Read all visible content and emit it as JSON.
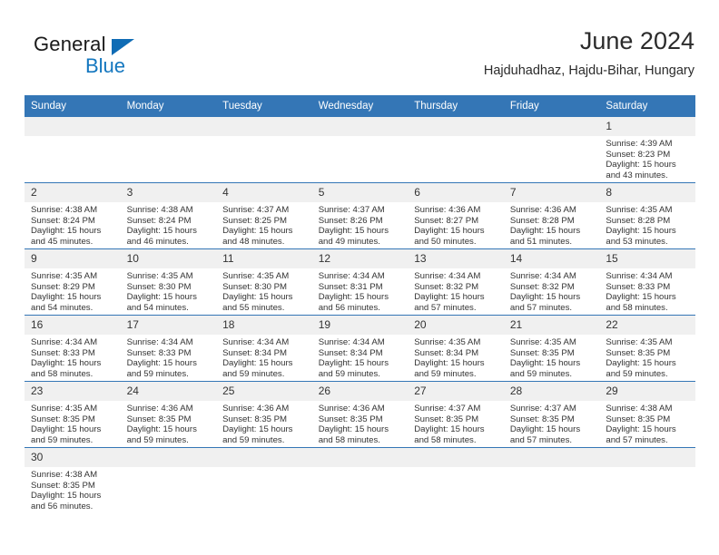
{
  "logo": {
    "word1": "General",
    "word2": "Blue",
    "triangle_color": "#0f6cb5",
    "word2_color": "#1477bf"
  },
  "header": {
    "title": "June 2024",
    "subtitle": "Hajduhadhaz, Hajdu-Bihar, Hungary"
  },
  "theme": {
    "header_blue": "#3476b6",
    "daynum_bg": "#f0f0f0",
    "text": "#333333"
  },
  "weekdays": [
    "Sunday",
    "Monday",
    "Tuesday",
    "Wednesday",
    "Thursday",
    "Friday",
    "Saturday"
  ],
  "labels": {
    "sunrise": "Sunrise:",
    "sunset": "Sunset:",
    "daylight": "Daylight:"
  },
  "weeks": [
    [
      {
        "day": "",
        "empty": true
      },
      {
        "day": "",
        "empty": true
      },
      {
        "day": "",
        "empty": true
      },
      {
        "day": "",
        "empty": true
      },
      {
        "day": "",
        "empty": true
      },
      {
        "day": "",
        "empty": true
      },
      {
        "day": "1",
        "sunrise": "Sunrise: 4:39 AM",
        "sunset": "Sunset: 8:23 PM",
        "daylight": "Daylight: 15 hours and 43 minutes."
      }
    ],
    [
      {
        "day": "2",
        "sunrise": "Sunrise: 4:38 AM",
        "sunset": "Sunset: 8:24 PM",
        "daylight": "Daylight: 15 hours and 45 minutes."
      },
      {
        "day": "3",
        "sunrise": "Sunrise: 4:38 AM",
        "sunset": "Sunset: 8:24 PM",
        "daylight": "Daylight: 15 hours and 46 minutes."
      },
      {
        "day": "4",
        "sunrise": "Sunrise: 4:37 AM",
        "sunset": "Sunset: 8:25 PM",
        "daylight": "Daylight: 15 hours and 48 minutes."
      },
      {
        "day": "5",
        "sunrise": "Sunrise: 4:37 AM",
        "sunset": "Sunset: 8:26 PM",
        "daylight": "Daylight: 15 hours and 49 minutes."
      },
      {
        "day": "6",
        "sunrise": "Sunrise: 4:36 AM",
        "sunset": "Sunset: 8:27 PM",
        "daylight": "Daylight: 15 hours and 50 minutes."
      },
      {
        "day": "7",
        "sunrise": "Sunrise: 4:36 AM",
        "sunset": "Sunset: 8:28 PM",
        "daylight": "Daylight: 15 hours and 51 minutes."
      },
      {
        "day": "8",
        "sunrise": "Sunrise: 4:35 AM",
        "sunset": "Sunset: 8:28 PM",
        "daylight": "Daylight: 15 hours and 53 minutes."
      }
    ],
    [
      {
        "day": "9",
        "sunrise": "Sunrise: 4:35 AM",
        "sunset": "Sunset: 8:29 PM",
        "daylight": "Daylight: 15 hours and 54 minutes."
      },
      {
        "day": "10",
        "sunrise": "Sunrise: 4:35 AM",
        "sunset": "Sunset: 8:30 PM",
        "daylight": "Daylight: 15 hours and 54 minutes."
      },
      {
        "day": "11",
        "sunrise": "Sunrise: 4:35 AM",
        "sunset": "Sunset: 8:30 PM",
        "daylight": "Daylight: 15 hours and 55 minutes."
      },
      {
        "day": "12",
        "sunrise": "Sunrise: 4:34 AM",
        "sunset": "Sunset: 8:31 PM",
        "daylight": "Daylight: 15 hours and 56 minutes."
      },
      {
        "day": "13",
        "sunrise": "Sunrise: 4:34 AM",
        "sunset": "Sunset: 8:32 PM",
        "daylight": "Daylight: 15 hours and 57 minutes."
      },
      {
        "day": "14",
        "sunrise": "Sunrise: 4:34 AM",
        "sunset": "Sunset: 8:32 PM",
        "daylight": "Daylight: 15 hours and 57 minutes."
      },
      {
        "day": "15",
        "sunrise": "Sunrise: 4:34 AM",
        "sunset": "Sunset: 8:33 PM",
        "daylight": "Daylight: 15 hours and 58 minutes."
      }
    ],
    [
      {
        "day": "16",
        "sunrise": "Sunrise: 4:34 AM",
        "sunset": "Sunset: 8:33 PM",
        "daylight": "Daylight: 15 hours and 58 minutes."
      },
      {
        "day": "17",
        "sunrise": "Sunrise: 4:34 AM",
        "sunset": "Sunset: 8:33 PM",
        "daylight": "Daylight: 15 hours and 59 minutes."
      },
      {
        "day": "18",
        "sunrise": "Sunrise: 4:34 AM",
        "sunset": "Sunset: 8:34 PM",
        "daylight": "Daylight: 15 hours and 59 minutes."
      },
      {
        "day": "19",
        "sunrise": "Sunrise: 4:34 AM",
        "sunset": "Sunset: 8:34 PM",
        "daylight": "Daylight: 15 hours and 59 minutes."
      },
      {
        "day": "20",
        "sunrise": "Sunrise: 4:35 AM",
        "sunset": "Sunset: 8:34 PM",
        "daylight": "Daylight: 15 hours and 59 minutes."
      },
      {
        "day": "21",
        "sunrise": "Sunrise: 4:35 AM",
        "sunset": "Sunset: 8:35 PM",
        "daylight": "Daylight: 15 hours and 59 minutes."
      },
      {
        "day": "22",
        "sunrise": "Sunrise: 4:35 AM",
        "sunset": "Sunset: 8:35 PM",
        "daylight": "Daylight: 15 hours and 59 minutes."
      }
    ],
    [
      {
        "day": "23",
        "sunrise": "Sunrise: 4:35 AM",
        "sunset": "Sunset: 8:35 PM",
        "daylight": "Daylight: 15 hours and 59 minutes."
      },
      {
        "day": "24",
        "sunrise": "Sunrise: 4:36 AM",
        "sunset": "Sunset: 8:35 PM",
        "daylight": "Daylight: 15 hours and 59 minutes."
      },
      {
        "day": "25",
        "sunrise": "Sunrise: 4:36 AM",
        "sunset": "Sunset: 8:35 PM",
        "daylight": "Daylight: 15 hours and 59 minutes."
      },
      {
        "day": "26",
        "sunrise": "Sunrise: 4:36 AM",
        "sunset": "Sunset: 8:35 PM",
        "daylight": "Daylight: 15 hours and 58 minutes."
      },
      {
        "day": "27",
        "sunrise": "Sunrise: 4:37 AM",
        "sunset": "Sunset: 8:35 PM",
        "daylight": "Daylight: 15 hours and 58 minutes."
      },
      {
        "day": "28",
        "sunrise": "Sunrise: 4:37 AM",
        "sunset": "Sunset: 8:35 PM",
        "daylight": "Daylight: 15 hours and 57 minutes."
      },
      {
        "day": "29",
        "sunrise": "Sunrise: 4:38 AM",
        "sunset": "Sunset: 8:35 PM",
        "daylight": "Daylight: 15 hours and 57 minutes."
      }
    ],
    [
      {
        "day": "30",
        "sunrise": "Sunrise: 4:38 AM",
        "sunset": "Sunset: 8:35 PM",
        "daylight": "Daylight: 15 hours and 56 minutes."
      },
      {
        "day": "",
        "empty": true
      },
      {
        "day": "",
        "empty": true
      },
      {
        "day": "",
        "empty": true
      },
      {
        "day": "",
        "empty": true
      },
      {
        "day": "",
        "empty": true
      },
      {
        "day": "",
        "empty": true
      }
    ]
  ]
}
